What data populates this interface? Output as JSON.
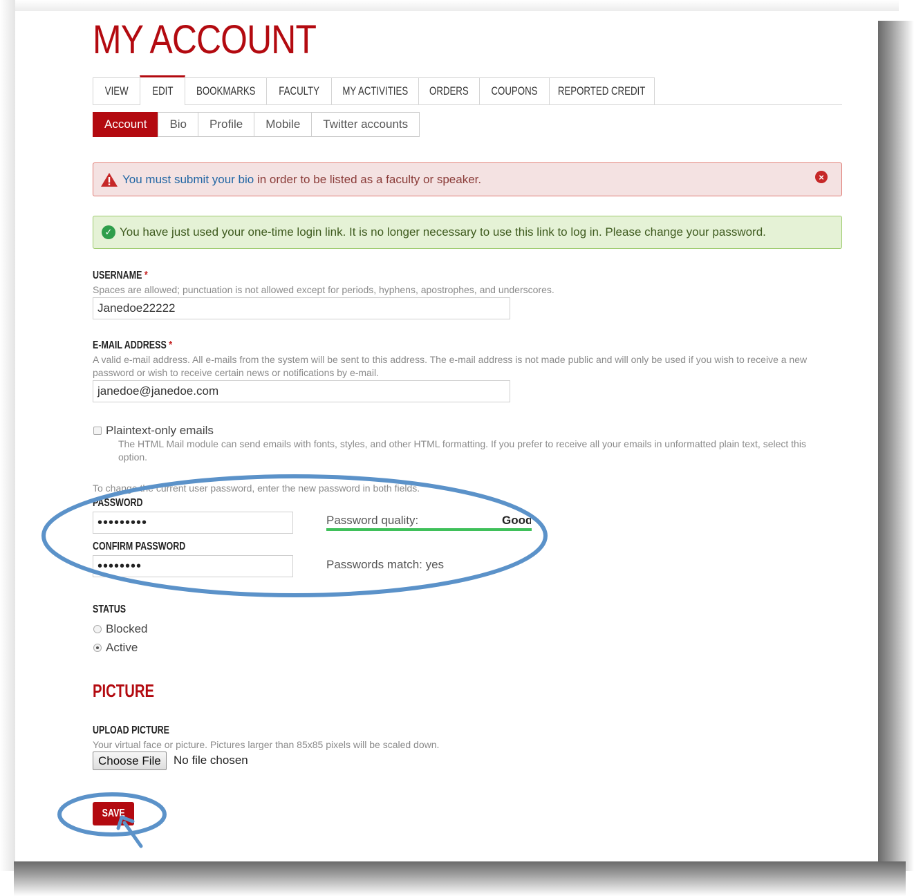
{
  "page": {
    "title": "MY ACCOUNT"
  },
  "tabs": [
    "VIEW",
    "EDIT",
    "BOOKMARKS",
    "FACULTY",
    "MY ACTIVITIES",
    "ORDERS",
    "COUPONS",
    "REPORTED CREDIT"
  ],
  "active_tab": "EDIT",
  "subtabs": [
    "Account",
    "Bio",
    "Profile",
    "Mobile",
    "Twitter accounts"
  ],
  "active_subtab": "Account",
  "messages": {
    "error": {
      "link_text": "You must submit your bio",
      "rest": " in order to be listed as a faculty or speaker."
    },
    "status": "You have just used your one-time login link. It is no longer necessary to use this link to log in. Please change your password."
  },
  "username": {
    "label": "USERNAME",
    "required_mark": "*",
    "description": "Spaces are allowed; punctuation is not allowed except for periods, hyphens, apostrophes, and underscores.",
    "value": "Janedoe22222"
  },
  "email": {
    "label": "E-MAIL ADDRESS",
    "required_mark": "*",
    "description": "A valid e-mail address. All e-mails from the system will be sent to this address. The e-mail address is not made public and will only be used if you wish to receive a new password or wish to receive certain news or notifications by e-mail.",
    "value": "janedoe@janedoe.com"
  },
  "plaintext": {
    "label": "Plaintext-only emails",
    "checked": false,
    "description": "The HTML Mail module can send emails with fonts, styles, and other HTML formatting. If you prefer to receive all your emails in unformatted plain text, select this option."
  },
  "password": {
    "intro": "To change the current user password, enter the new password in both fields.",
    "label": "PASSWORD",
    "value": "•••••••••",
    "confirm_label": "CONFIRM PASSWORD",
    "confirm_value": "••••••••",
    "quality_label": "Password quality:",
    "quality_value": "Good",
    "quality_fraction": 1.0,
    "match_text": "Passwords match: yes"
  },
  "status": {
    "label": "STATUS",
    "options": [
      "Blocked",
      "Active"
    ],
    "selected": "Active"
  },
  "picture": {
    "section_title": "PICTURE",
    "upload_label": "UPLOAD PICTURE",
    "description": "Your virtual face or picture. Pictures larger than 85x85 pixels will be scaled down.",
    "button_label": "Choose File",
    "no_file_text": "No file chosen"
  },
  "save_label": "SAVE",
  "colors": {
    "brand_red": "#b30a10",
    "annotation_blue": "#5b92c9",
    "quality_green": "#3fc05a"
  }
}
